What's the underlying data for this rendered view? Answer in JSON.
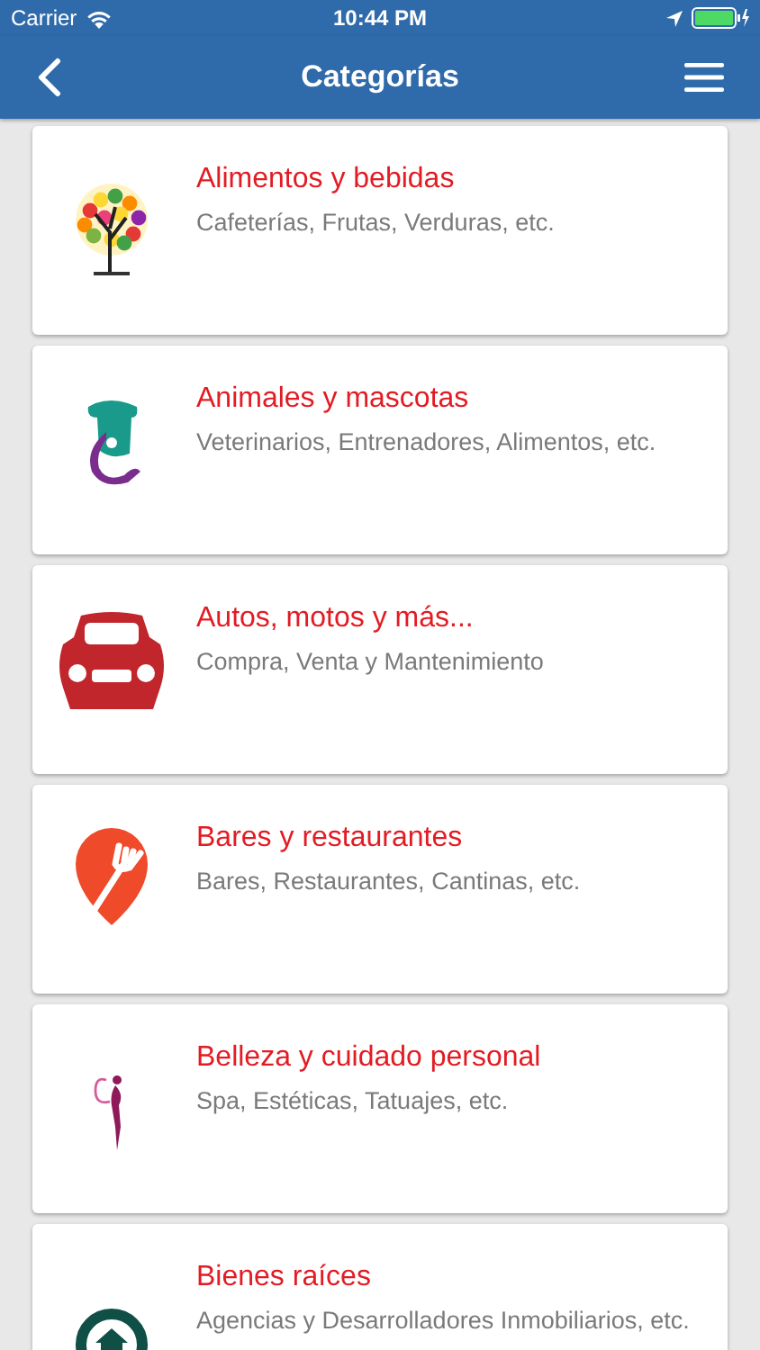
{
  "status_bar": {
    "carrier": "Carrier",
    "time": "10:44 PM"
  },
  "nav_bar": {
    "title": "Categorías"
  },
  "categories": [
    {
      "kind": "tree",
      "title": "Alimentos y bebidas",
      "subtitle": "Cafeterías, Frutas, Verduras, etc."
    },
    {
      "kind": "pet",
      "title": "Animales y mascotas",
      "subtitle": "Veterinarios, Entrenadores, Alimentos, etc."
    },
    {
      "kind": "car",
      "title": "Autos, motos y más...",
      "subtitle": "Compra, Venta y Mantenimiento"
    },
    {
      "kind": "fork",
      "title": "Bares y restaurantes",
      "subtitle": "Bares, Restaurantes, Cantinas, etc."
    },
    {
      "kind": "beauty",
      "title": "Belleza y cuidado personal",
      "subtitle": "Spa, Estéticas, Tatuajes, etc."
    },
    {
      "kind": "house",
      "title": "Bienes raíces",
      "subtitle": "Agencias y Desarrolladores Inmobiliarios, etc."
    }
  ]
}
